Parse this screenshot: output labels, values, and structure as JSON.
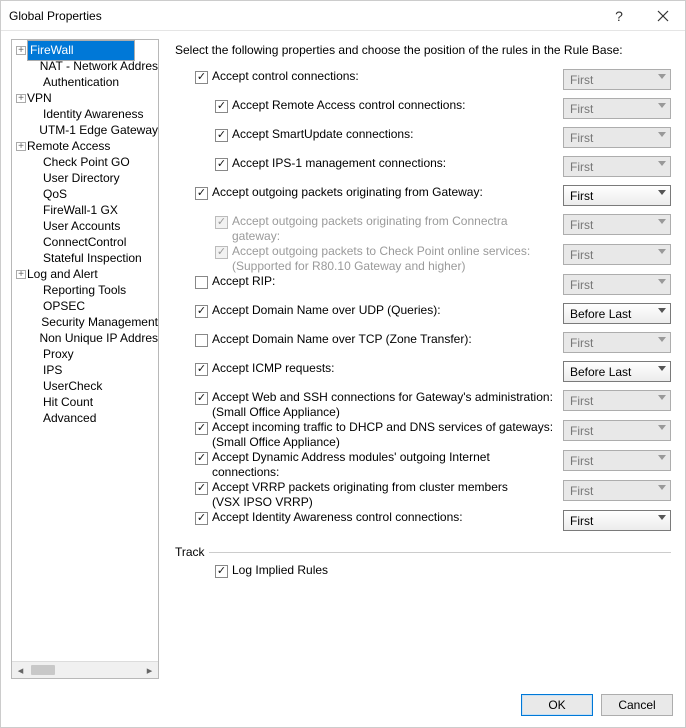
{
  "window": {
    "title": "Global Properties"
  },
  "tree": {
    "items": [
      {
        "label": "FireWall",
        "level": 1,
        "collapsed": true,
        "selected": true
      },
      {
        "label": "NAT - Network Addres",
        "level": 2
      },
      {
        "label": "Authentication",
        "level": 2
      },
      {
        "label": "VPN",
        "level": 1,
        "collapsed": true
      },
      {
        "label": "Identity Awareness",
        "level": 2
      },
      {
        "label": "UTM-1 Edge Gateway",
        "level": 2
      },
      {
        "label": "Remote Access",
        "level": 1,
        "collapsed": true
      },
      {
        "label": "Check Point GO",
        "level": 2
      },
      {
        "label": "User Directory",
        "level": 2
      },
      {
        "label": "QoS",
        "level": 2
      },
      {
        "label": "FireWall-1 GX",
        "level": 2
      },
      {
        "label": "User Accounts",
        "level": 2
      },
      {
        "label": "ConnectControl",
        "level": 2
      },
      {
        "label": "Stateful Inspection",
        "level": 2
      },
      {
        "label": "Log and Alert",
        "level": 1,
        "collapsed": true
      },
      {
        "label": "Reporting Tools",
        "level": 2
      },
      {
        "label": "OPSEC",
        "level": 2
      },
      {
        "label": "Security Management ",
        "level": 2
      },
      {
        "label": "Non Unique IP Addres",
        "level": 2
      },
      {
        "label": "Proxy",
        "level": 2
      },
      {
        "label": "IPS",
        "level": 2
      },
      {
        "label": "UserCheck",
        "level": 2
      },
      {
        "label": "Hit Count",
        "level": 2
      },
      {
        "label": "Advanced",
        "level": 2
      }
    ]
  },
  "main": {
    "intro": "Select the following properties and choose the position of the rules in the Rule Base:",
    "options": [
      {
        "id": "ctrl",
        "level": 1,
        "checked": true,
        "enabled": true,
        "label": "Accept control connections:",
        "sel": "First",
        "selEnabled": false
      },
      {
        "id": "ra",
        "level": 2,
        "checked": true,
        "enabled": true,
        "label": "Accept Remote Access control connections:",
        "sel": "First",
        "selEnabled": false
      },
      {
        "id": "su",
        "level": 2,
        "checked": true,
        "enabled": true,
        "label": "Accept SmartUpdate connections:",
        "sel": "First",
        "selEnabled": false
      },
      {
        "id": "ips1",
        "level": 2,
        "checked": true,
        "enabled": true,
        "label": "Accept IPS-1 management connections:",
        "sel": "First",
        "selEnabled": false
      },
      {
        "id": "outgw",
        "level": 1,
        "checked": true,
        "enabled": true,
        "label": "Accept outgoing packets originating from Gateway:",
        "sel": "First",
        "selEnabled": true
      },
      {
        "id": "outcon",
        "level": 2,
        "checked": true,
        "enabled": false,
        "label": "Accept outgoing packets originating from Connectra gateway:",
        "sel": "First",
        "selEnabled": false
      },
      {
        "id": "outcp",
        "level": 2,
        "checked": true,
        "enabled": false,
        "label": "Accept outgoing packets to Check Point online services:",
        "sub": "(Supported for R80.10 Gateway and higher)",
        "sel": "First",
        "selEnabled": false
      },
      {
        "id": "rip",
        "level": 1,
        "checked": false,
        "enabled": true,
        "label": "Accept RIP:",
        "sel": "First",
        "selEnabled": false
      },
      {
        "id": "dnsudp",
        "level": 1,
        "checked": true,
        "enabled": true,
        "label": "Accept Domain Name over UDP (Queries):",
        "sel": "Before Last",
        "selEnabled": true
      },
      {
        "id": "dnstcp",
        "level": 1,
        "checked": false,
        "enabled": true,
        "label": "Accept Domain Name over TCP (Zone Transfer):",
        "sel": "First",
        "selEnabled": false
      },
      {
        "id": "icmp",
        "level": 1,
        "checked": true,
        "enabled": true,
        "label": "Accept ICMP requests:",
        "sel": "Before Last",
        "selEnabled": true
      },
      {
        "id": "webssh",
        "level": 1,
        "checked": true,
        "enabled": true,
        "label": "Accept Web and SSH connections for Gateway's administration:",
        "sub": "(Small Office Appliance)",
        "sel": "First",
        "selEnabled": false
      },
      {
        "id": "dhcpdns",
        "level": 1,
        "checked": true,
        "enabled": true,
        "label": "Accept incoming traffic to DHCP and DNS services of gateways:",
        "sub": "(Small Office Appliance)",
        "sel": "First",
        "selEnabled": false
      },
      {
        "id": "dyn",
        "level": 1,
        "checked": true,
        "enabled": true,
        "label": "Accept Dynamic Address modules' outgoing Internet connections:",
        "sel": "First",
        "selEnabled": false
      },
      {
        "id": "vrrp",
        "level": 1,
        "checked": true,
        "enabled": true,
        "label": "Accept VRRP packets originating from cluster members",
        "sub": "(VSX IPSO VRRP)",
        "sel": "First",
        "selEnabled": false
      },
      {
        "id": "ida",
        "level": 1,
        "checked": true,
        "enabled": true,
        "label": "Accept Identity Awareness control connections:",
        "sel": "First",
        "selEnabled": true
      }
    ],
    "track": {
      "legend": "Track",
      "log_checked": true,
      "log_label": "Log Implied Rules"
    }
  },
  "footer": {
    "ok": "OK",
    "cancel": "Cancel"
  }
}
